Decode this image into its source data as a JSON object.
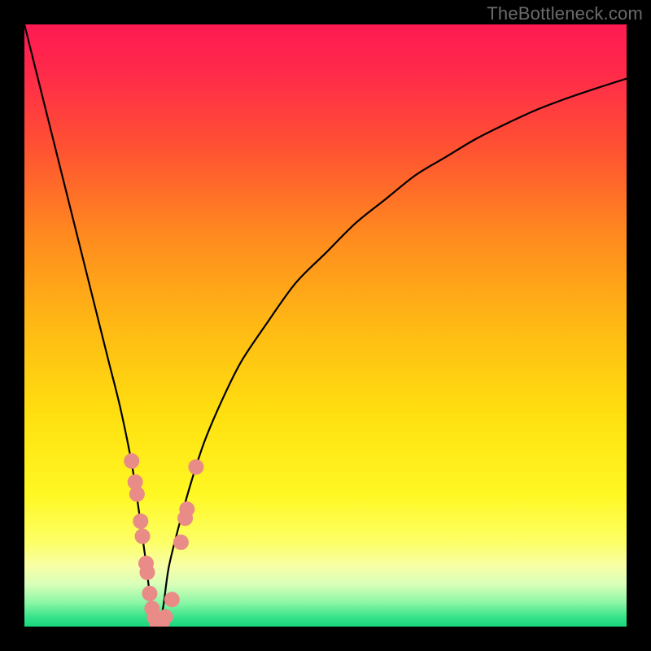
{
  "watermark": "TheBottleneck.com",
  "colors": {
    "gradient_stops": [
      {
        "offset": 0.0,
        "color": "#ff1a52"
      },
      {
        "offset": 0.08,
        "color": "#ff2a4a"
      },
      {
        "offset": 0.2,
        "color": "#ff5033"
      },
      {
        "offset": 0.35,
        "color": "#ff8a1f"
      },
      {
        "offset": 0.5,
        "color": "#ffb914"
      },
      {
        "offset": 0.65,
        "color": "#ffe010"
      },
      {
        "offset": 0.78,
        "color": "#fff823"
      },
      {
        "offset": 0.86,
        "color": "#fdff66"
      },
      {
        "offset": 0.9,
        "color": "#f7ffa8"
      },
      {
        "offset": 0.93,
        "color": "#d8ffb8"
      },
      {
        "offset": 0.96,
        "color": "#8cf7a6"
      },
      {
        "offset": 0.985,
        "color": "#35e28a"
      },
      {
        "offset": 1.0,
        "color": "#17d67e"
      }
    ],
    "curve": "#000000",
    "marker_fill": "#e98b86",
    "marker_stroke": "#e98b86",
    "frame": "#000000"
  },
  "chart_data": {
    "type": "line",
    "title": "",
    "xlabel": "",
    "ylabel": "",
    "xlim": [
      0,
      100
    ],
    "ylim": [
      0,
      100
    ],
    "x_min_at": 22,
    "series": [
      {
        "name": "bottleneck-curve",
        "x": [
          0,
          2,
          4,
          6,
          8,
          10,
          12,
          14,
          16,
          18,
          20,
          21,
          22,
          23,
          24,
          26,
          28,
          30,
          33,
          36,
          40,
          45,
          50,
          55,
          60,
          65,
          70,
          75,
          80,
          85,
          90,
          95,
          100
        ],
        "values": [
          100,
          92,
          84,
          76,
          68,
          60,
          52,
          44,
          36,
          26,
          12,
          4,
          0,
          3,
          10,
          18,
          25,
          31,
          38,
          44,
          50,
          57,
          62,
          67,
          71,
          75,
          78,
          81,
          83.5,
          85.8,
          87.7,
          89.4,
          91
        ]
      }
    ],
    "markers": {
      "name": "highlighted-points",
      "points": [
        {
          "x": 17.8,
          "y": 27.5
        },
        {
          "x": 18.4,
          "y": 24.0
        },
        {
          "x": 18.7,
          "y": 22.0
        },
        {
          "x": 19.3,
          "y": 17.5
        },
        {
          "x": 19.6,
          "y": 15.0
        },
        {
          "x": 20.2,
          "y": 10.5
        },
        {
          "x": 20.4,
          "y": 9.0
        },
        {
          "x": 20.8,
          "y": 5.5
        },
        {
          "x": 21.2,
          "y": 3.0
        },
        {
          "x": 21.6,
          "y": 1.5
        },
        {
          "x": 22.0,
          "y": 0.4
        },
        {
          "x": 22.8,
          "y": 0.6
        },
        {
          "x": 23.4,
          "y": 1.6
        },
        {
          "x": 24.5,
          "y": 4.5
        },
        {
          "x": 26.0,
          "y": 14.0
        },
        {
          "x": 26.7,
          "y": 18.0
        },
        {
          "x": 27.0,
          "y": 19.5
        },
        {
          "x": 28.5,
          "y": 26.5
        }
      ]
    }
  }
}
